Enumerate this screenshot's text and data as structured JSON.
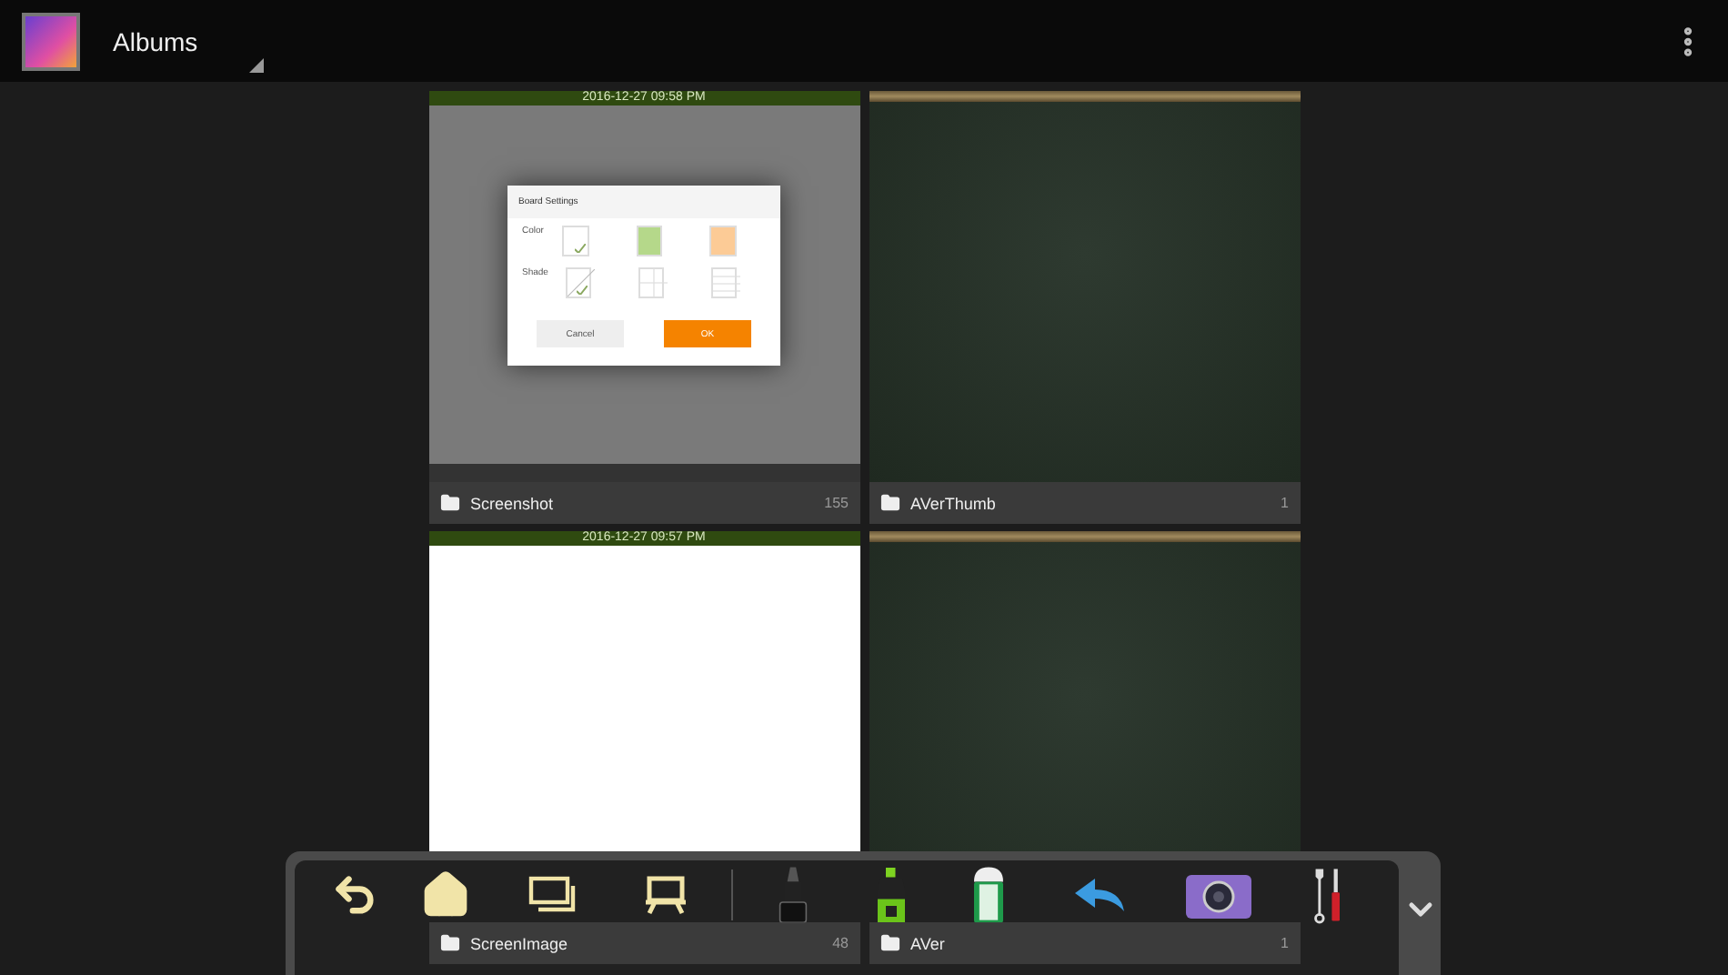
{
  "app_bar": {
    "title": "Albums"
  },
  "albums": [
    {
      "name": "Screenshot",
      "count": "155",
      "thumbnail": {
        "kind": "screenshot",
        "timestamp": "2016-12-27 09:58 PM",
        "dialog": {
          "title": "Board Settings",
          "rows": [
            {
              "label": "Color",
              "options": [
                {
                  "kind": "swatch",
                  "color": "#ffffff",
                  "selected": true
                },
                {
                  "kind": "swatch",
                  "color": "#b5d88a",
                  "selected": false
                },
                {
                  "kind": "swatch",
                  "color": "#fccb96",
                  "selected": false
                }
              ]
            },
            {
              "label": "Shade",
              "options": [
                {
                  "kind": "diagonal",
                  "selected": true
                },
                {
                  "kind": "grid",
                  "selected": false
                },
                {
                  "kind": "lines",
                  "selected": false
                }
              ]
            }
          ],
          "buttons": [
            {
              "label": "Cancel",
              "kind": "secondary"
            },
            {
              "label": "OK",
              "kind": "primary"
            }
          ]
        }
      }
    },
    {
      "name": "AVerThumb",
      "count": "1",
      "thumbnail": {
        "kind": "chalkboard"
      }
    },
    {
      "name": "ScreenImage",
      "count": "48",
      "thumbnail": {
        "kind": "blank",
        "timestamp": "2016-12-27 09:57 PM"
      }
    },
    {
      "name": "AVer",
      "count": "1",
      "thumbnail": {
        "kind": "chalkboard"
      }
    }
  ]
}
